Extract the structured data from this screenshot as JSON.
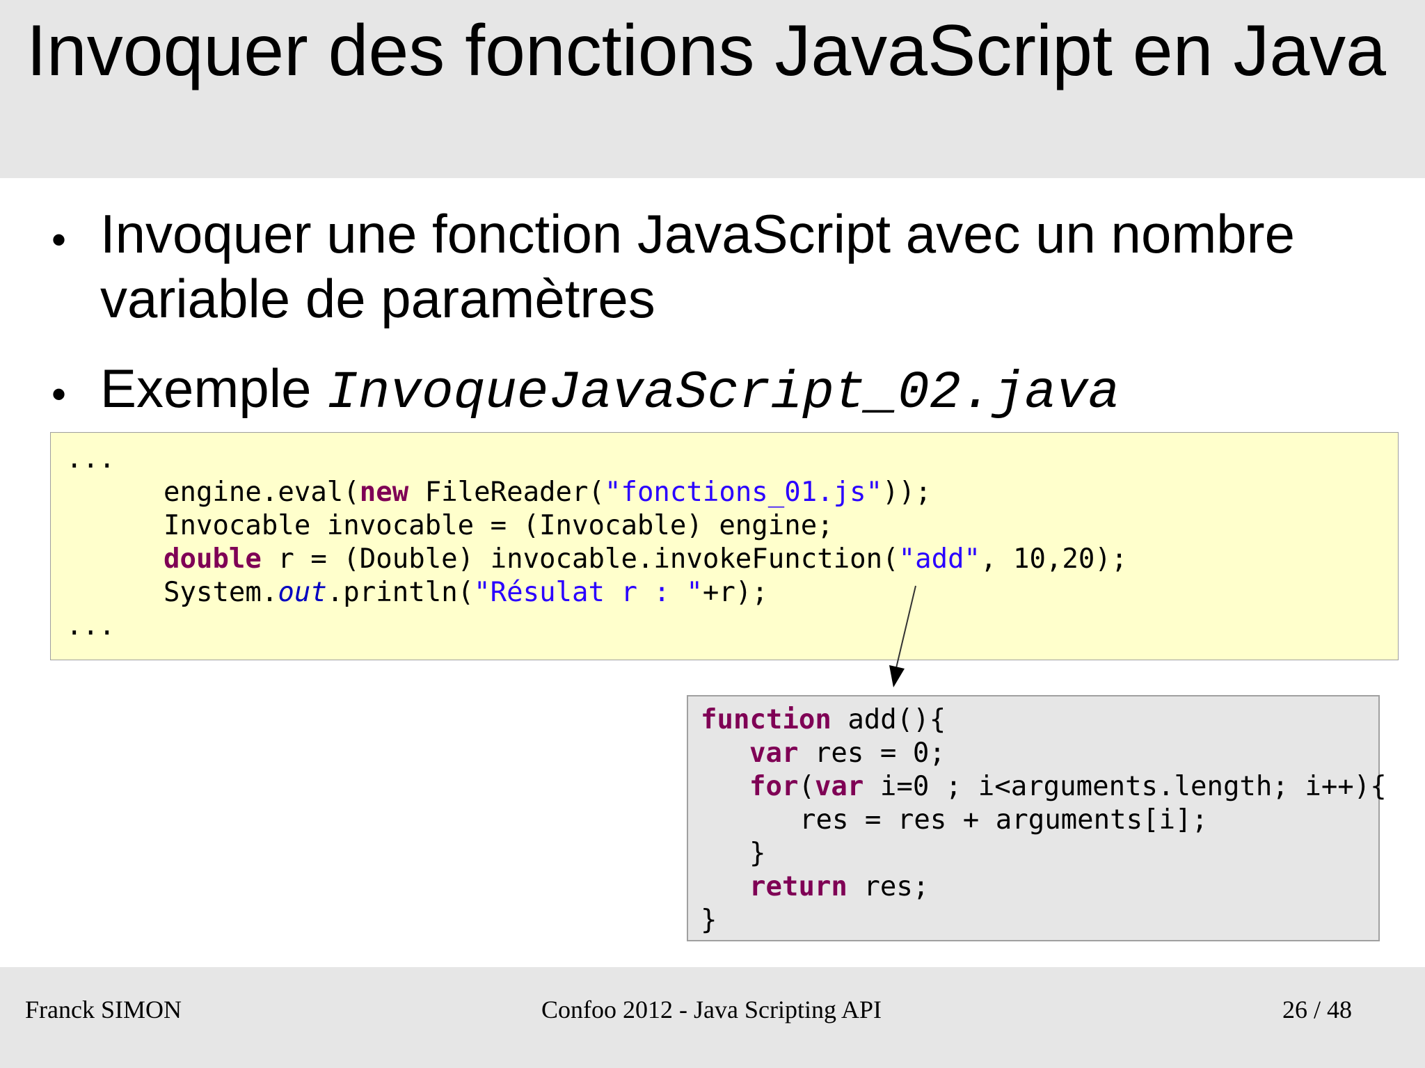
{
  "slide": {
    "title": "Invoquer des fonctions JavaScript en Java",
    "bullets": [
      {
        "text": "Invoquer une fonction JavaScript avec un nombre variable de paramètres"
      },
      {
        "text": "Exemple ",
        "code": "InvoqueJavaScript_02.java"
      }
    ]
  },
  "java_code": {
    "ellipsis": "...",
    "line1": {
      "pre": "engine.eval(",
      "kw": "new",
      "mid": " FileReader(",
      "str": "\"fonctions_01.js\"",
      "post": "));"
    },
    "line2": {
      "text": "Invocable invocable = (Invocable) engine;"
    },
    "line3": {
      "kw": "double",
      "mid": " r = (Double) invocable.invokeFunction(",
      "str": "\"add\"",
      "post": ", 10,20);"
    },
    "line4": {
      "pre": "System.",
      "ital": "out",
      "mid": ".println(",
      "str": "\"Résulat r : \"",
      "post": "+r);"
    }
  },
  "js_code": {
    "line1": {
      "kw": "function",
      "post": " add(){"
    },
    "line2": {
      "kw": "var",
      "post": " res = 0;"
    },
    "line3": {
      "kw1": "for",
      "sep": "(",
      "kw2": "var",
      "post": " i=0 ; i<arguments.length; i++){"
    },
    "line4": {
      "text": "res = res + arguments[i];"
    },
    "line5": {
      "text": "}"
    },
    "line6": {
      "kw": "return",
      "post": " res;"
    },
    "line7": {
      "text": "}"
    }
  },
  "footer": {
    "author": "Franck SIMON",
    "event": "Confoo 2012 - Java Scripting API",
    "page": "26 / 48"
  }
}
